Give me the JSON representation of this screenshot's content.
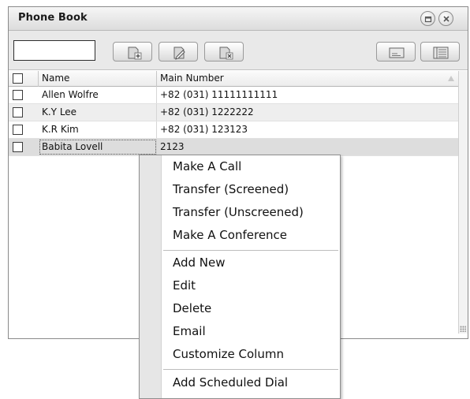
{
  "window": {
    "title": "Phone Book"
  },
  "toolbar": {
    "search_value": ""
  },
  "grid": {
    "columns": [
      "Name",
      "Main Number"
    ],
    "rows": [
      {
        "name": "Allen Wolfre",
        "number": "+82 (031) 11111111111"
      },
      {
        "name": "K.Y Lee",
        "number": "+82 (031) 1222222"
      },
      {
        "name": "K.R Kim",
        "number": "+82 (031) 123123"
      },
      {
        "name": "Babita Lovell",
        "number": "2123"
      }
    ]
  },
  "context_menu": {
    "items": [
      "Make A Call",
      "Transfer (Screened)",
      "Transfer (Unscreened)",
      "Make A Conference",
      "Add New",
      "Edit",
      "Delete",
      "Email",
      "Customize Column",
      "Add Scheduled Dial"
    ]
  },
  "colors": {
    "title_bg": "#e6e6e6",
    "toolbar_bg": "#e9e9e9",
    "row_alt": "#eeeeee",
    "selected_row": "#dddddd",
    "menu_gutter": "#e6e6e6"
  },
  "icons": {
    "restore": "restore-icon",
    "close": "close-icon",
    "add_contact": "add-contact-icon",
    "edit_contact": "edit-contact-icon",
    "delete_contact": "delete-contact-icon",
    "card_view": "card-view-icon",
    "list_view": "list-view-icon"
  }
}
